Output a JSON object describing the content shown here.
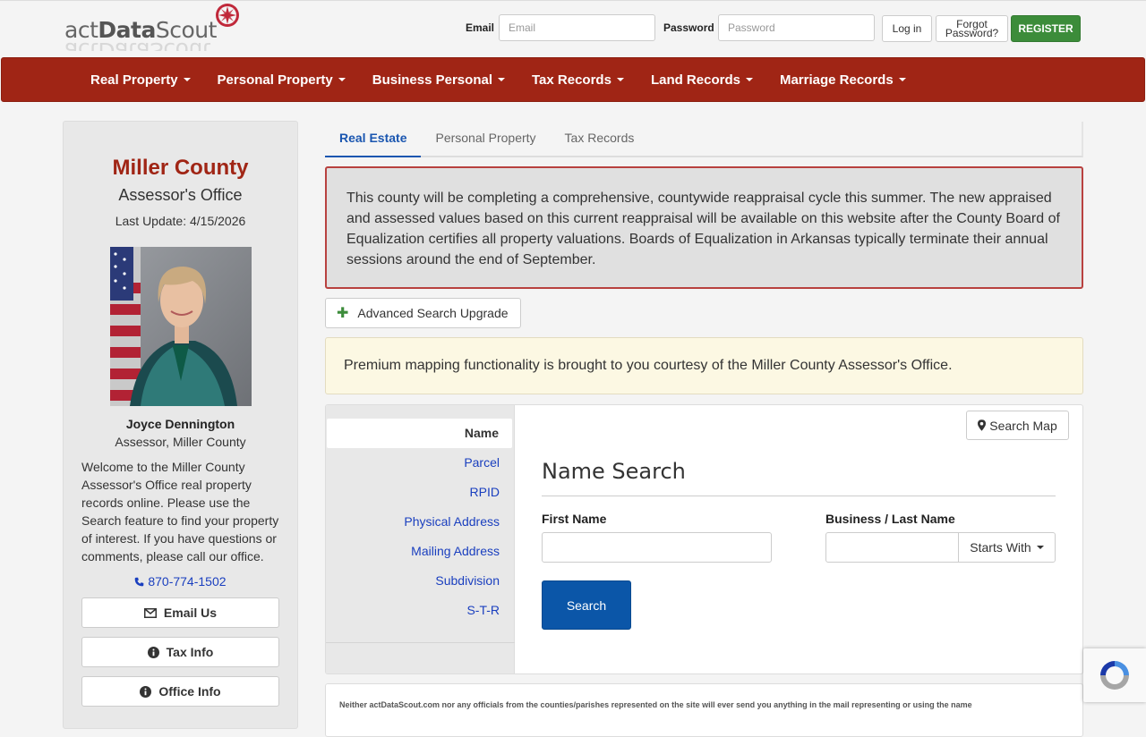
{
  "header": {
    "logo_text_light": "act",
    "logo_text_bold": "Data",
    "logo_text_end": "Scout",
    "email_label": "Email",
    "email_placeholder": "Email",
    "password_label": "Password",
    "password_placeholder": "Password",
    "login_label": "Log in",
    "forgot_line1": "Forgot",
    "forgot_line2": "Password?",
    "register_label": "REGISTER"
  },
  "nav": {
    "items": [
      {
        "label": "Real Property"
      },
      {
        "label": "Personal Property"
      },
      {
        "label": "Business Personal"
      },
      {
        "label": "Tax Records"
      },
      {
        "label": "Land Records"
      },
      {
        "label": "Marriage Records"
      }
    ]
  },
  "sidebar": {
    "county": "Miller County",
    "office": "Assessor's Office",
    "last_update": "Last Update: 4/15/2026",
    "assessor_name": "Joyce Dennington",
    "assessor_title": "Assessor, Miller County",
    "welcome": "Welcome to the Miller County Assessor's Office real property records online. Please use the Search feature to find your property of interest. If you have questions or comments, please call our office.",
    "phone": "870-774-1502",
    "buttons": [
      {
        "label": "Email Us",
        "icon": "envelope-icon"
      },
      {
        "label": "Tax Info",
        "icon": "info-icon"
      },
      {
        "label": "Office Info",
        "icon": "info-icon"
      }
    ]
  },
  "tabs": [
    {
      "label": "Real Estate",
      "active": true
    },
    {
      "label": "Personal Property",
      "active": false
    },
    {
      "label": "Tax Records",
      "active": false
    }
  ],
  "alert_text": "This county will be completing a comprehensive, countywide reappraisal cycle this summer. The new appraised and assessed values based on this current reappraisal will be available on this website after the County Board of Equalization certifies all property valuations. Boards of Equalization in Arkansas typically terminate their annual sessions around the end of September.",
  "advanced_search_label": "Advanced Search Upgrade",
  "premium_text": "Premium mapping functionality is brought to you courtesy of the Miller County Assessor's Office.",
  "search": {
    "options": [
      "Name",
      "Parcel",
      "RPID",
      "Physical Address",
      "Mailing Address",
      "Subdivision",
      "S-T-R"
    ],
    "active_option": "Name",
    "map_button": "Search Map",
    "title": "Name Search",
    "first_name_label": "First Name",
    "last_name_label": "Business / Last Name",
    "match_mode": "Starts With",
    "search_button": "Search"
  },
  "disclaimer": "Neither actDataScout.com nor any officials from the counties/parishes represented on the site will ever send you anything in the mail representing or using the name",
  "colors": {
    "brand_red": "#a02515",
    "primary_blue": "#0b56a8",
    "register_green": "#3c8c3a"
  }
}
